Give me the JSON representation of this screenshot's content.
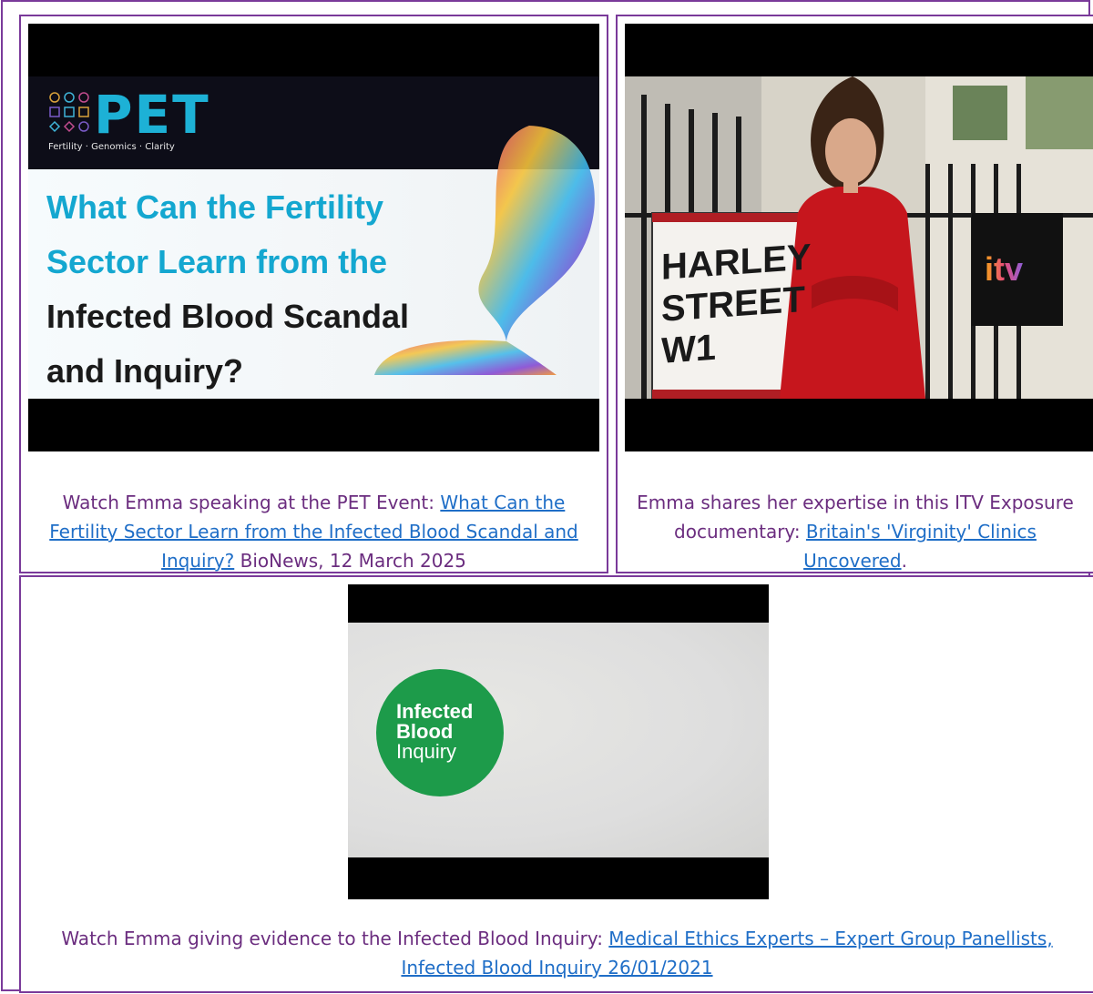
{
  "items": [
    {
      "thumbnail": {
        "logo_text": "PET",
        "tagline": "Fertility · Genomics · Clarity",
        "title_cyan_1": "What Can the Fertility",
        "title_cyan_2": "Sector Learn from the",
        "title_dark_1": "Infected Blood Scandal",
        "title_dark_2": "and Inquiry?"
      },
      "caption_prefix": "Watch Emma speaking at the PET Event: ",
      "link_text": "What Can the Fertility Sector Learn from the Infected Blood Scandal and Inquiry?",
      "caption_suffix": " BioNews, 12 March 2025"
    },
    {
      "thumbnail": {
        "sign_line_1": "HARLEY",
        "sign_line_2": "STREET W1",
        "channel_logo": "itv"
      },
      "caption_prefix": "Emma shares her expertise in this ITV Exposure documentary: ",
      "link_text": "Britain's 'Virginity' Clinics Uncovered",
      "caption_suffix": "."
    },
    {
      "thumbnail": {
        "logo_line_1": "Infected",
        "logo_line_2": "Blood",
        "logo_line_3": "Inquiry"
      },
      "caption_prefix": "Watch Emma giving evidence to the Infected Blood Inquiry: ",
      "link_text": "Medical Ethics Experts – Expert Group Panellists, Infected Blood Inquiry 26/01/2021",
      "caption_suffix": ""
    }
  ],
  "colors": {
    "border": "#7a3a9a",
    "caption_text": "#6b2d7f",
    "link": "#1f6ec7"
  }
}
